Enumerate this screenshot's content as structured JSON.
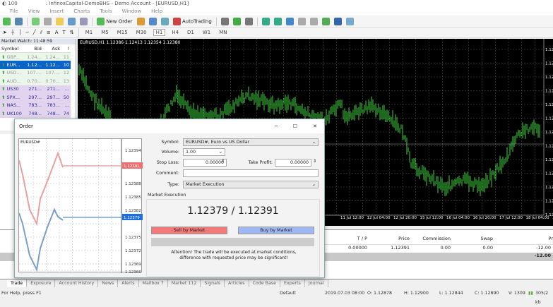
{
  "window": {
    "title": "100",
    "subtitle": ": InfinoxCapital-DemoBHS - Demo Account - [EURUSD,H1]"
  },
  "menu": [
    "File",
    "View",
    "Insert",
    "Charts",
    "Tools",
    "Window",
    "Help"
  ],
  "toolbar": {
    "new_order": "New Order",
    "autotrading": "AutoTrading",
    "timeframes": [
      "M1",
      "M5",
      "M15",
      "M30",
      "H1",
      "H4",
      "D1",
      "W1",
      "MN"
    ]
  },
  "market_watch": {
    "header": "Market Watch: 11:48:59",
    "columns": [
      "Symbol",
      "Bid",
      "Ask",
      "!"
    ],
    "rows": [
      [
        "GBP...",
        "1.24...",
        "1.24...",
        "11"
      ],
      [
        "EUR...",
        "1.12...",
        "1.12...",
        "10"
      ],
      [
        "USD...",
        "107....",
        "107....",
        "12"
      ],
      [
        "AUD...",
        "0.70...",
        "0.70...",
        "13"
      ],
      [
        "US30",
        "271...",
        "271...",
        "..."
      ],
      [
        "SPX...",
        "297...",
        "297...",
        "50"
      ],
      [
        "NAS...",
        "783...",
        "783...",
        "..."
      ],
      [
        "UK100",
        "748...",
        "748...",
        "74"
      ]
    ]
  },
  "chart": {
    "header": "EURUSD,H1  1.12386 1.12413 1.12354 1.12380",
    "time_labels": [
      "11 Jul 12:00",
      "12 Jul 04:00",
      "12 Jul 20:00",
      "15 Jul 12:00",
      "16 Jul 04:00",
      "16 Jul 20:00",
      "17 Jul 12:00",
      "18 Jul 04:00"
    ],
    "price_label": "1.12"
  },
  "terminal": {
    "columns": [
      "T / P",
      "Price",
      "Commission",
      "Swap",
      "Pr"
    ],
    "row": [
      "0.00000",
      "1.12391",
      "0.00",
      "0.00",
      "-12.00"
    ],
    "total": "-12.00",
    "tabs": [
      "Trade",
      "Exposure",
      "Account History",
      "News",
      "Alerts",
      "Mailbox 7",
      "Market 112",
      "Signals",
      "Articles",
      "Code Base",
      "Experts",
      "Journal"
    ]
  },
  "status": {
    "help": "For Help, press F1",
    "profile": "Default",
    "time": "2019.07.03 08:00",
    "o": "O: 1.12878",
    "h": "H: 1.12900",
    "l": "L: 1.12844",
    "c": "C: 1.12890",
    "v": "V: 1309",
    "traffic": "305/2 kb"
  },
  "order": {
    "title": "Order",
    "mini_symbol": "EURUSD#",
    "mini_prices": [
      "1.12394",
      "1.12388",
      "1.12385",
      "1.12382",
      "1.12375",
      "1.12372",
      "1.12369",
      "1.12366"
    ],
    "ask_tag": "1.12391",
    "bid_tag": "1.12379",
    "symbol_label": "Symbol:",
    "symbol": "EURUSD#, Euro vs US Dollar",
    "volume_label": "Volume:",
    "volume": "1.00",
    "sl_label": "Stop Loss:",
    "sl": "0.00000",
    "tp_label": "Take Profit:",
    "tp": "0.00000",
    "comment_label": "Comment:",
    "comment": "",
    "type_label": "Type:",
    "type": "Market Execution",
    "section": "Market Execution",
    "quote_bid": "1.12379",
    "quote_sep": " / ",
    "quote_ask": "1.12391",
    "sell": "Sell by Market",
    "buy": "Buy by Market",
    "attention": "Attention! The trade will be executed at market conditions, difference with requested price may be significant!"
  },
  "colors": {
    "sell": "#f47a7a",
    "buy": "#9fb8f4",
    "candle": "#3cd23c",
    "selected": "#0a64c8"
  }
}
